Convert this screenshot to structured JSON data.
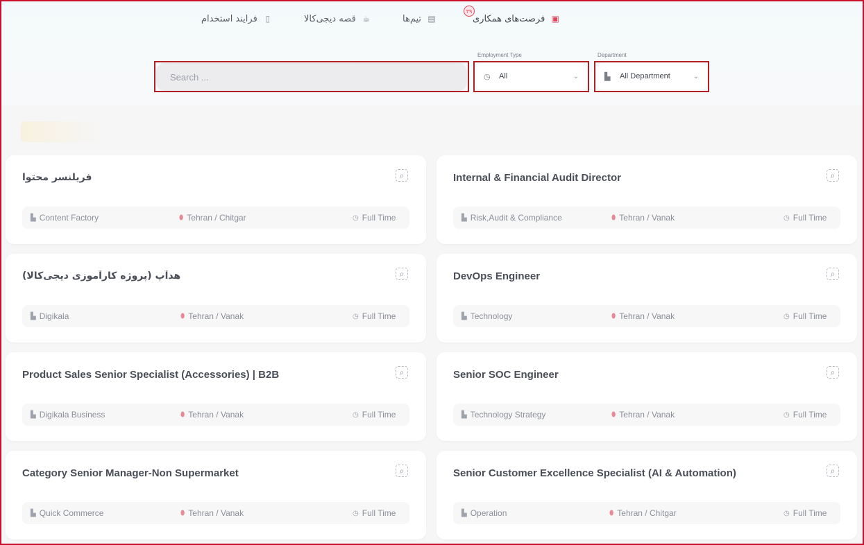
{
  "nav": {
    "items": [
      {
        "label": "فرصت‌های همکاری",
        "icon": "briefcase-icon",
        "active": true,
        "badge": "۳۹"
      },
      {
        "label": "تیم‌ها",
        "icon": "id-card-icon",
        "active": false
      },
      {
        "label": "قصه دیجی‌کالا",
        "icon": "coffee-cup-icon",
        "active": false
      },
      {
        "label": "فرایند استخدام",
        "icon": "clipboard-icon",
        "active": false
      }
    ]
  },
  "filters": {
    "search_placeholder": "Search ...",
    "employment_type": {
      "label": "Employment Type",
      "value": "All",
      "icon": "clock-icon"
    },
    "department": {
      "label": "Department",
      "value": "All Department",
      "icon": "building-icon"
    }
  },
  "jobs": [
    {
      "title": "فریلنسر محتوا",
      "department": "Content Factory",
      "location": "Tehran / Chitgar",
      "type": "Full Time"
    },
    {
      "title": "Internal & Financial Audit Director",
      "department": "Risk,Audit & Compliance",
      "location": "Tehran / Vanak",
      "type": "Full Time"
    },
    {
      "title": "هدآپ (پروژه کارآموزی دیجی‌کالا)",
      "department": "Digikala",
      "location": "Tehran / Vanak",
      "type": "Full Time"
    },
    {
      "title": "DevOps Engineer",
      "department": "Technology",
      "location": "Tehran / Vanak",
      "type": "Full Time"
    },
    {
      "title": "Product Sales Senior Specialist (Accessories) | B2B",
      "department": "Digikala Business",
      "location": "Tehran / Vanak",
      "type": "Full Time"
    },
    {
      "title": "Senior SOC Engineer",
      "department": "Technology Strategy",
      "location": "Tehran / Vanak",
      "type": "Full Time"
    },
    {
      "title": "Category Senior Manager-Non Supermarket",
      "department": "Quick Commerce",
      "location": "Tehran / Vanak",
      "type": "Full Time"
    },
    {
      "title": "Senior Customer Excellence Specialist (AI & Automation)",
      "department": "Operation",
      "location": "Tehran / Chitgar",
      "type": "Full Time"
    }
  ],
  "colors": {
    "accent": "#e0465b",
    "highlight_border": "#b21f24"
  }
}
